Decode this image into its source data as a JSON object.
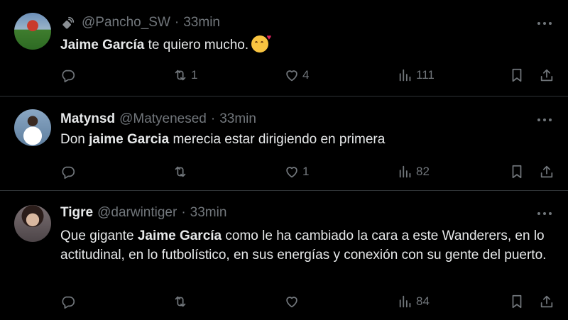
{
  "tweets": [
    {
      "name": "",
      "handle": "@Pancho_SW",
      "time": "33min",
      "text_bold": "Jaime García",
      "text_rest": " te quiero mucho.",
      "replies": "",
      "retweets": "1",
      "likes": "4",
      "views": "111"
    },
    {
      "name": "Matynsd",
      "handle": "@Matyenesed",
      "time": "33min",
      "text_pre": "Don ",
      "text_bold": "jaime Garcia",
      "text_rest": " merecia estar dirigiendo en primera",
      "replies": "",
      "retweets": "",
      "likes": "1",
      "views": "82"
    },
    {
      "name": "Tigre",
      "handle": "@darwintiger",
      "time": "33min",
      "text_pre": "Que gigante ",
      "text_bold": "Jaime García",
      "text_rest": " como le ha cambiado la cara a este Wanderers, en lo actitudinal, en lo futbolístico, en sus energías y conexión con su gente del puerto.",
      "replies": "",
      "retweets": "",
      "likes": "",
      "views": "84"
    }
  ],
  "sep": "·",
  "colors": {
    "background": "#000000",
    "text": "#e7e9ea",
    "muted": "#71767b",
    "divider": "#2f3336"
  },
  "icons": [
    "satellite-icon",
    "reply-icon",
    "retweet-icon",
    "like-icon",
    "views-icon",
    "bookmark-icon",
    "share-icon",
    "more-icon"
  ]
}
